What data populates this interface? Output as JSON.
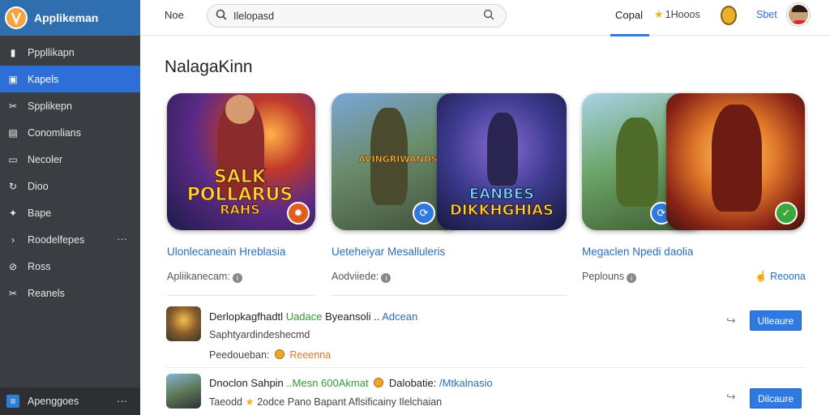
{
  "app": {
    "name": "Applikeman"
  },
  "sidebar": {
    "items": [
      {
        "label": "Pppllikapn",
        "icon": "folder-icon",
        "active": false
      },
      {
        "label": "Kapels",
        "icon": "grid-icon",
        "active": true
      },
      {
        "label": "Spplikepn",
        "icon": "tools-icon",
        "active": false
      },
      {
        "label": "Conomlians",
        "icon": "chat-icon",
        "active": false
      },
      {
        "label": "Necoler",
        "icon": "inbox-icon",
        "active": false
      },
      {
        "label": "Dioo",
        "icon": "link-icon",
        "active": false
      },
      {
        "label": "Bape",
        "icon": "wrench-icon",
        "active": false
      },
      {
        "label": "Roodelfepes",
        "icon": "chevron-icon",
        "active": false,
        "more": "···"
      },
      {
        "label": "Ross",
        "icon": "tag-icon",
        "active": false
      },
      {
        "label": "Reanels",
        "icon": "tools-icon",
        "active": false
      }
    ],
    "footer": {
      "label": "Apenggoes",
      "more": "···"
    }
  },
  "topbar": {
    "nav_label": "Noe",
    "search": {
      "value": "Ilelopasd",
      "placeholder": ""
    },
    "active_tab": "Copal",
    "rating_label": "1Hooos",
    "link": "Sbet"
  },
  "main": {
    "section_title": "NalagaKinn",
    "cards": [
      {
        "art_text_1": "SALK",
        "art_text_2": "POLLARUS",
        "art_text_3": "RAHS",
        "title": "Ulonlecaneain Hreblasia",
        "meta": "Apliikanecam:",
        "badge_icon": "fire-icon"
      },
      {
        "art_text_left": "AVINGRIWANDS",
        "art_text_1": "EANBES",
        "art_text_2": "DIKKHGHIAS",
        "title": "Ueteheiyar Mesalluleris",
        "meta": "Aodviiede:",
        "badge_icon": "share-icon"
      },
      {
        "title": "Megaclen Npedi daolia",
        "meta": "Peplouns",
        "action": "Reoona",
        "badge_left_icon": "share-icon",
        "badge_right_icon": "check-icon"
      }
    ],
    "list": [
      {
        "line1_a": "Derlopkagfhadtl",
        "line1_b": "Uadace",
        "line1_c": "Byeansoli ..",
        "line1_d": "Adcean",
        "line2": "Saphtyardindeshecmd",
        "line3_a": "Peedoueban:",
        "line3_b": "Reeenna",
        "button": "Ulleaure"
      },
      {
        "line1_a": "Dnoclon Sahpin",
        "line1_b": "..Mesn 600Akmat",
        "line1_c": "Dalobatie:",
        "line1_d": "/Mtkalnasio",
        "line2_a": "Taeodd",
        "line2_b": "2odce Pano Bapant Aflsificainy Ilelchaian",
        "button": "Dilcaure"
      }
    ]
  }
}
